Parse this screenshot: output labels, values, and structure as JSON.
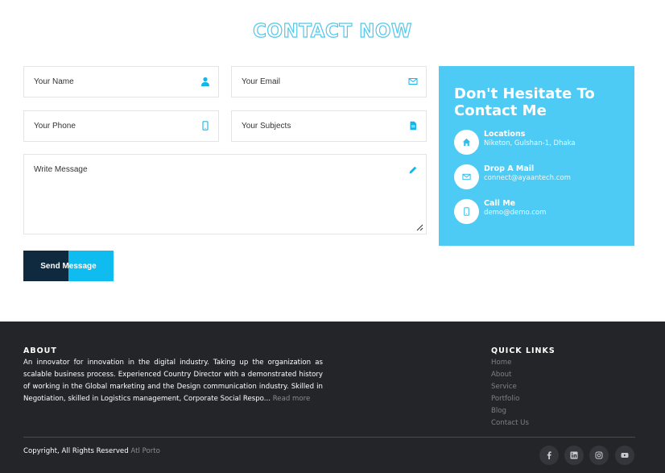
{
  "contact": {
    "title": "CONTACT NOW",
    "form": {
      "name_placeholder": "Your Name",
      "email_placeholder": "Your Email",
      "phone_placeholder": "Your Phone",
      "subject_placeholder": "Your Subjects",
      "message_placeholder": "Write Message",
      "send_label": "Send Message"
    },
    "info": {
      "heading": "Don't Hesitate To Contact Me",
      "items": [
        {
          "icon": "home-icon",
          "title": "Locations",
          "value": "Niketon, Gulshan-1, Dhaka"
        },
        {
          "icon": "envelope-icon",
          "title": "Drop A Mail",
          "value": "connect@ayaantech.com"
        },
        {
          "icon": "mobile-icon",
          "title": "Call Me",
          "value": "demo@demo.com"
        }
      ]
    },
    "colors": {
      "accent": "#0fbcf0",
      "card": "#4ecbf5",
      "dark": "#0f2a3e"
    }
  },
  "footer": {
    "about_heading": "ABOUT",
    "about_text": "An innovator for innovation in the digital industry. Taking up the organization as scalable business process. Experienced Country Director with a demonstrated history of working in the Global marketing and the Design communication industry. Skilled in Negotiation, skilled in Logistics management, Corporate Social Respo...",
    "read_more": "Read more",
    "quick_links_heading": "QUICK LINKS",
    "quick_links": [
      "Home",
      "About",
      "Service",
      "Portfolio",
      "Blog",
      "Contact Us"
    ],
    "copyright": "Copyright, All Rights Reserved",
    "brand": "Atl Porto",
    "socials": [
      "facebook-icon",
      "linkedin-icon",
      "instagram-icon",
      "youtube-icon"
    ],
    "colors": {
      "background": "#242528"
    }
  }
}
